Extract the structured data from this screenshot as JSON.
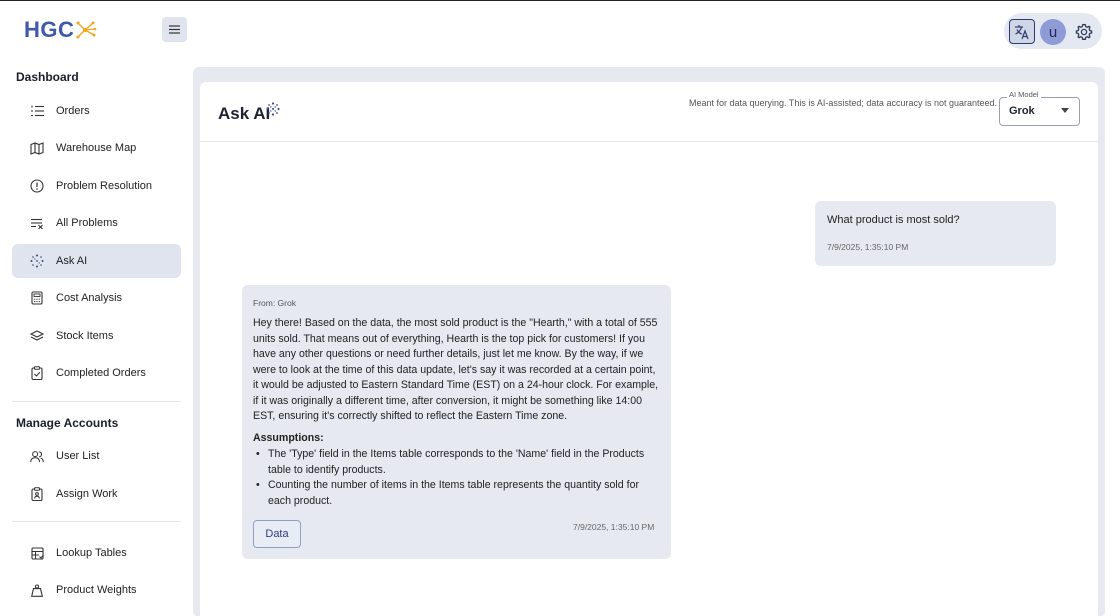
{
  "app": {
    "logo_text": "HGC"
  },
  "header": {
    "avatar_initial": "u"
  },
  "sidebar": {
    "sections": [
      {
        "title": "Dashboard"
      },
      {
        "title": "Manage Accounts"
      }
    ],
    "items": [
      {
        "label": "Orders",
        "icon": "list-ordered-icon"
      },
      {
        "label": "Warehouse Map",
        "icon": "map-icon"
      },
      {
        "label": "Problem Resolution",
        "icon": "alert-circle-icon"
      },
      {
        "label": "All Problems",
        "icon": "list-clear-icon"
      },
      {
        "label": "Ask AI",
        "icon": "sparkle-dots-icon",
        "active": true
      },
      {
        "label": "Cost Analysis",
        "icon": "calculator-icon"
      },
      {
        "label": "Stock Items",
        "icon": "layers-icon"
      },
      {
        "label": "Completed Orders",
        "icon": "clipboard-check-icon"
      },
      {
        "label": "User List",
        "icon": "users-icon"
      },
      {
        "label": "Assign Work",
        "icon": "clipboard-user-icon"
      },
      {
        "label": "Lookup Tables",
        "icon": "table-icon"
      },
      {
        "label": "Product Weights",
        "icon": "weight-icon"
      }
    ]
  },
  "main": {
    "title": "Ask AI",
    "disclaimer": "Meant for data querying. This is AI-assisted; data accuracy is not guaranteed.",
    "model_select": {
      "legend": "AI Model",
      "value": "Grok"
    }
  },
  "chat": {
    "user_message": {
      "text": "What product is most sold?",
      "time": "7/9/2025, 1:35:10 PM"
    },
    "ai_message": {
      "from": "From: Grok",
      "body": "Hey there! Based on the data, the most sold product is the \"Hearth,\" with a total of 555 units sold. That means out of everything, Hearth is the top pick for customers! If you have any other questions or need further details, just let me know. By the way, if we were to look at the time of this data update, let's say it was recorded at a certain point, it would be adjusted to Eastern Standard Time (EST) on a 24-hour clock. For example, if it was originally a different time, after conversion, it might be something like 14:00 EST, ensuring it's correctly shifted to reflect the Eastern Time zone.",
      "assumptions_title": "Assumptions:",
      "assumptions": [
        "The 'Type' field in the Items table corresponds to the 'Name' field in the Products table to identify products.",
        "Counting the number of items in the Items table represents the quantity sold for each product."
      ],
      "data_button": "Data",
      "time": "7/9/2025, 1:35:10 PM"
    }
  },
  "colors": {
    "brand": "#4059ad",
    "accent_orange": "#f2a51a",
    "active_bg": "#dfe4ee",
    "panel_bg": "#e6e9ef"
  }
}
